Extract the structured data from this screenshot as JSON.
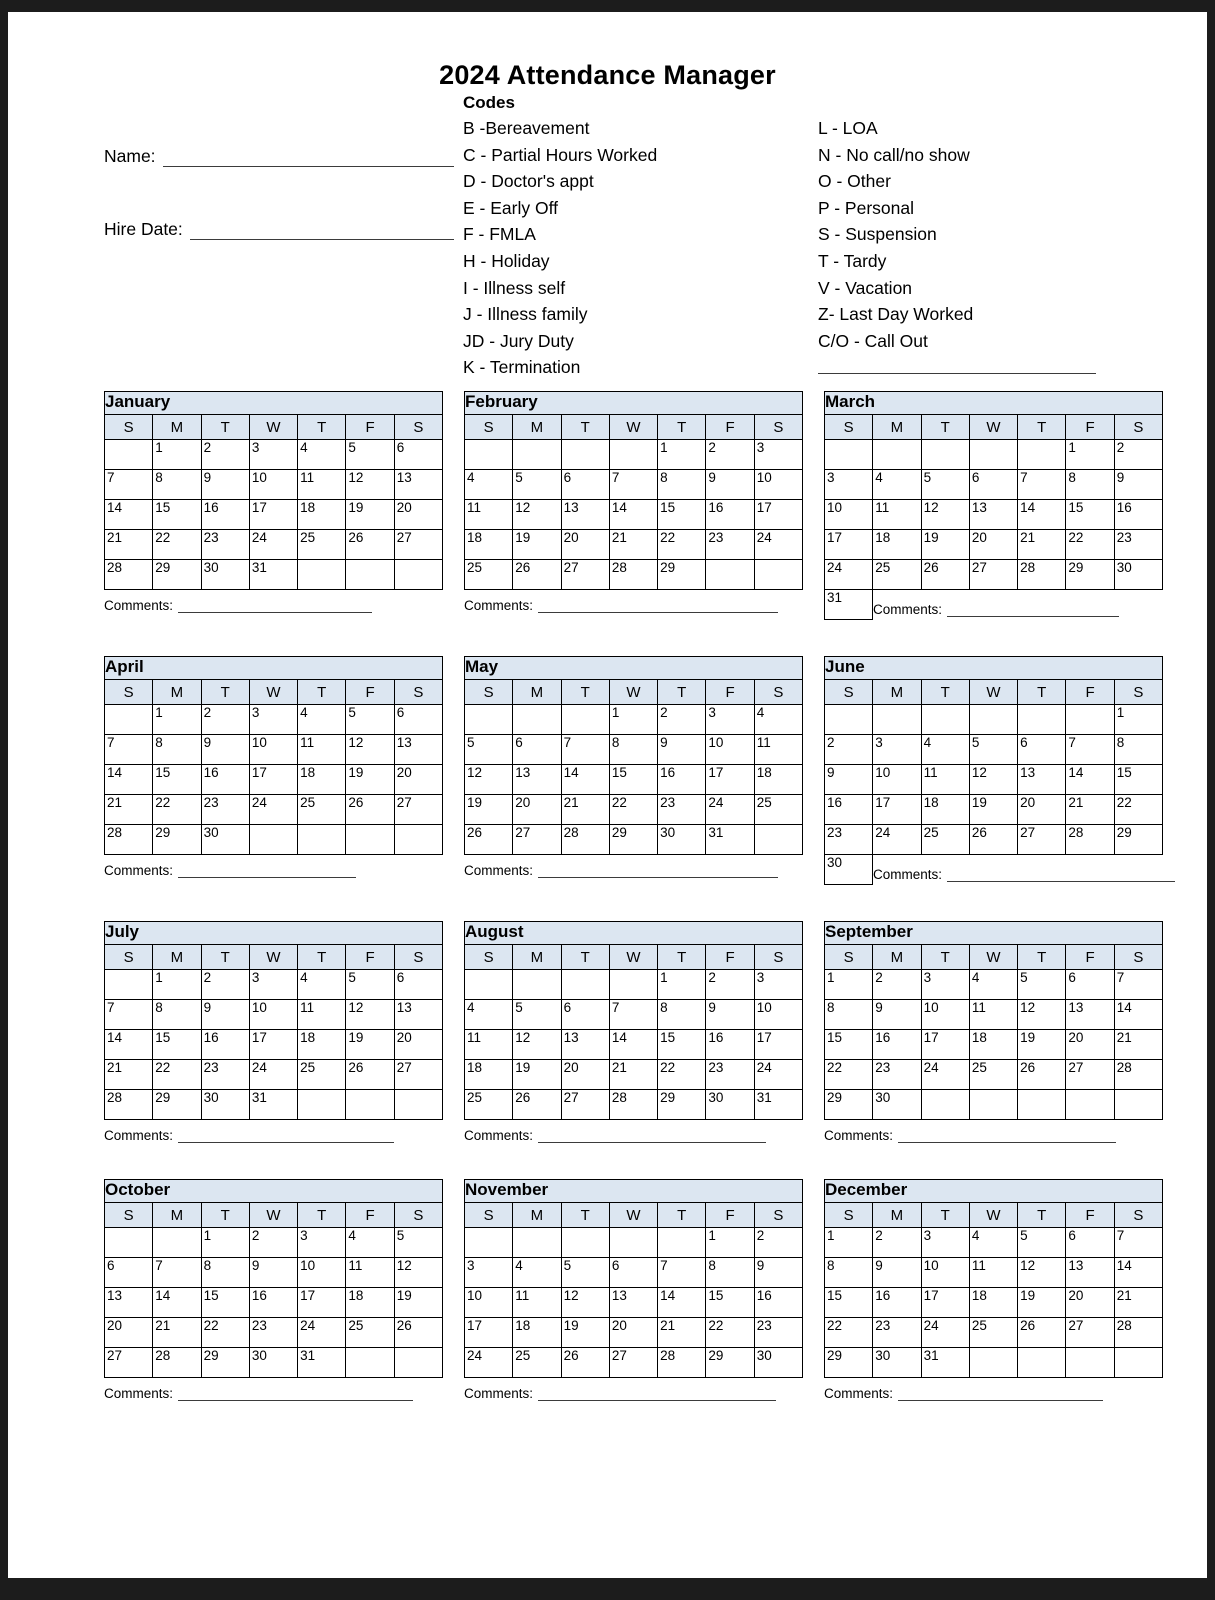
{
  "document": {
    "title": "2024 Attendance Manager"
  },
  "form": {
    "fields": [
      {
        "label": "Name:"
      },
      {
        "label": "Hire Date:"
      }
    ]
  },
  "codes": {
    "heading": "Codes",
    "left": [
      "B -Bereavement",
      "C - Partial Hours Worked",
      "D - Doctor's appt",
      "E - Early Off",
      "F - FMLA",
      "H - Holiday",
      "I - Illness self",
      "J - Illness family",
      "JD - Jury Duty",
      "K - Termination"
    ],
    "right": [
      "L - LOA",
      "N - No call/no show",
      "O - Other",
      "P - Personal",
      "S - Suspension",
      "T - Tardy",
      "V - Vacation",
      "Z- Last Day Worked",
      "C/O - Call Out"
    ]
  },
  "calendar": {
    "year": "2024",
    "daynames": [
      "S",
      "M",
      "T",
      "W",
      "T",
      "F",
      "S"
    ],
    "comments_label": "Comments:",
    "months": [
      {
        "name": "January",
        "start": 1,
        "days": 31,
        "comment_width": 194
      },
      {
        "name": "February",
        "start": 4,
        "days": 29,
        "comment_width": 240
      },
      {
        "name": "March",
        "start": 5,
        "days": 31,
        "comment_width": 172
      },
      {
        "name": "April",
        "start": 1,
        "days": 30,
        "comment_width": 178
      },
      {
        "name": "May",
        "start": 3,
        "days": 31,
        "comment_width": 240
      },
      {
        "name": "June",
        "start": 6,
        "days": 30,
        "comment_width": 228
      },
      {
        "name": "July",
        "start": 1,
        "days": 31,
        "comment_width": 216
      },
      {
        "name": "August",
        "start": 4,
        "days": 31,
        "comment_width": 228
      },
      {
        "name": "September",
        "start": 0,
        "days": 30,
        "comment_width": 218
      },
      {
        "name": "October",
        "start": 2,
        "days": 31,
        "comment_width": 235
      },
      {
        "name": "November",
        "start": 5,
        "days": 30,
        "comment_width": 238
      },
      {
        "name": "December",
        "start": 0,
        "days": 31,
        "comment_width": 205
      }
    ]
  },
  "colors": {
    "header_fill": "#dce6f1",
    "grid_line": "#000000",
    "page_background": "#ffffff",
    "frame": "#1c1c1c"
  }
}
